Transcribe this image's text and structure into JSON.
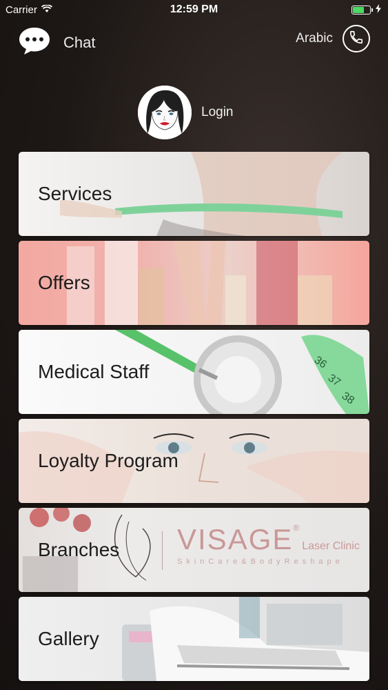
{
  "status": {
    "carrier": "Carrier",
    "time": "12:59 PM",
    "battery_level": 0.7
  },
  "top_bar": {
    "chat_label": "Chat",
    "language_label": "Arabic",
    "chat_icon": "chat-bubble-icon",
    "phone_icon": "phone-icon"
  },
  "login": {
    "label": "Login",
    "avatar_icon": "woman-face-icon"
  },
  "menu": {
    "items": [
      {
        "label": "Services"
      },
      {
        "label": "Offers"
      },
      {
        "label": "Medical Staff"
      },
      {
        "label": "Loyalty Program"
      },
      {
        "label": "Branches"
      },
      {
        "label": "Gallery"
      }
    ]
  },
  "branding": {
    "name": "VISAGE",
    "registered": "®",
    "subtitle": "Laser Clinic",
    "tagline": "SkinCare&BodyReshape"
  },
  "colors": {
    "background": "#1d1816",
    "accent_green": "#4cd964",
    "logo_rose": "#c99898"
  }
}
